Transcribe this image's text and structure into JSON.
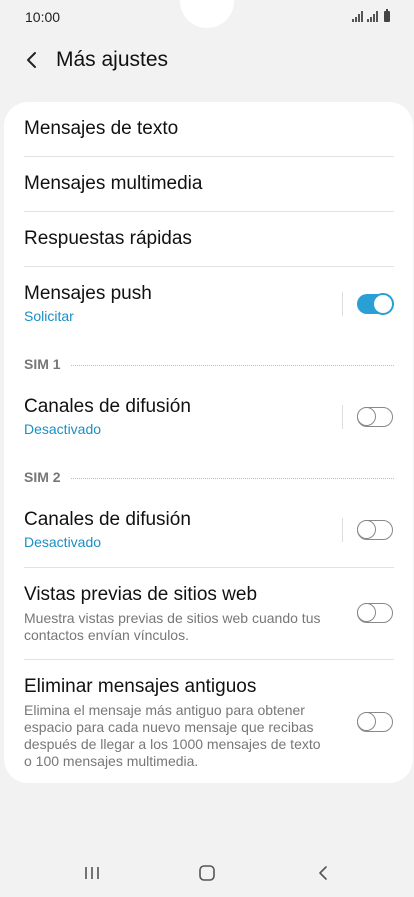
{
  "status": {
    "time": "10:00"
  },
  "header": {
    "title": "Más ajustes"
  },
  "items": {
    "text": {
      "title": "Mensajes de texto"
    },
    "mms": {
      "title": "Mensajes multimedia"
    },
    "quick": {
      "title": "Respuestas rápidas"
    },
    "push": {
      "title": "Mensajes push",
      "subtitle": "Solicitar",
      "enabled": true
    },
    "sim1_header": "SIM 1",
    "sim1_broadcast": {
      "title": "Canales de difusión",
      "subtitle": "Desactivado",
      "enabled": false
    },
    "sim2_header": "SIM 2",
    "sim2_broadcast": {
      "title": "Canales de difusión",
      "subtitle": "Desactivado",
      "enabled": false
    },
    "web_preview": {
      "title": "Vistas previas de sitios web",
      "description": "Muestra vistas previas de sitios web cuando tus contactos envían vínculos.",
      "enabled": false
    },
    "delete_old": {
      "title": "Eliminar mensajes antiguos",
      "description": "Elimina el mensaje más antiguo para obtener espacio para cada nuevo mensaje que recibas después de llegar a los 1000 mensajes de texto o 100 mensajes multimedia.",
      "enabled": false
    }
  },
  "colors": {
    "accent": "#2a9fd6",
    "subtitle": "#1a8fc4"
  },
  "nav": {
    "recents": "recents-icon",
    "home": "home-icon",
    "back": "back-nav-icon"
  }
}
